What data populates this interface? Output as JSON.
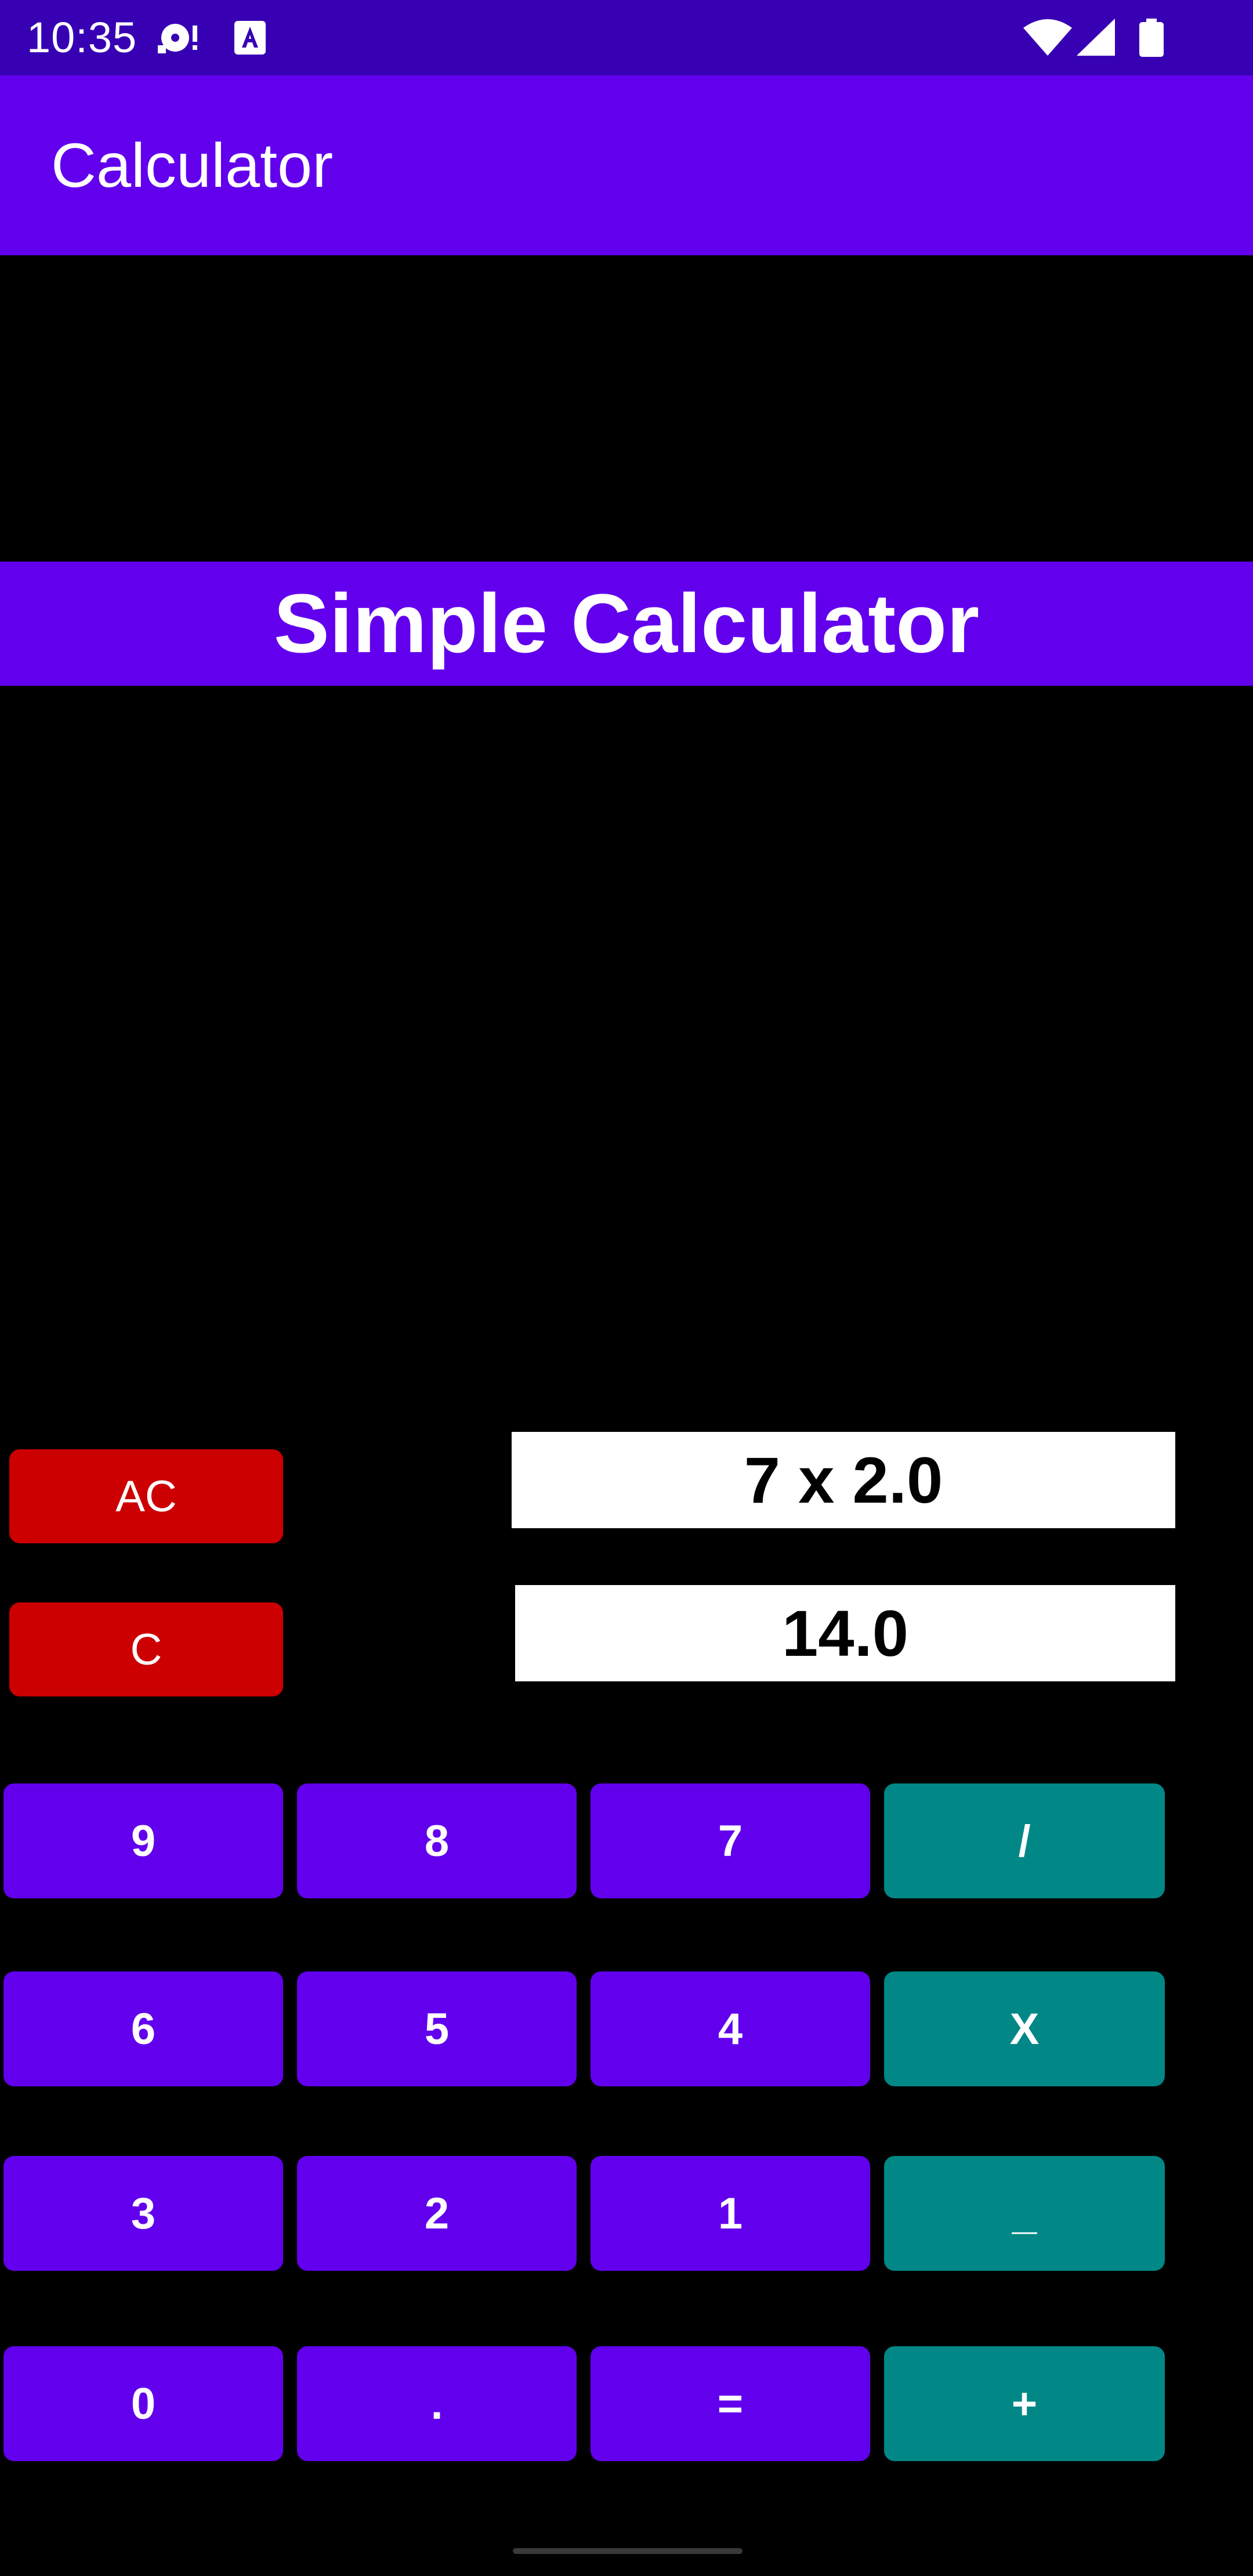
{
  "status_bar": {
    "time": "10:35",
    "icons": [
      "media-icon",
      "accessibility-a-icon",
      "wifi-icon",
      "cell-signal-icon",
      "battery-icon"
    ]
  },
  "app_bar": {
    "title": "Calculator"
  },
  "heading": "Simple Calculator",
  "controls": {
    "all_clear": "AC",
    "clear": "C"
  },
  "display": {
    "expression": "7 x 2.0",
    "result": "14.0"
  },
  "keypad": {
    "row1": [
      "9",
      "8",
      "7",
      "/"
    ],
    "row2": [
      "6",
      "5",
      "4",
      "X"
    ],
    "row3": [
      "3",
      "2",
      "1",
      "_"
    ],
    "row4": [
      "0",
      ".",
      "=",
      "+"
    ]
  },
  "colors": {
    "status_bar": "#3700B3",
    "primary": "#6200EE",
    "operator": "#018786",
    "danger": "#CC0000",
    "background": "#000000",
    "display_bg": "#FFFFFF"
  }
}
